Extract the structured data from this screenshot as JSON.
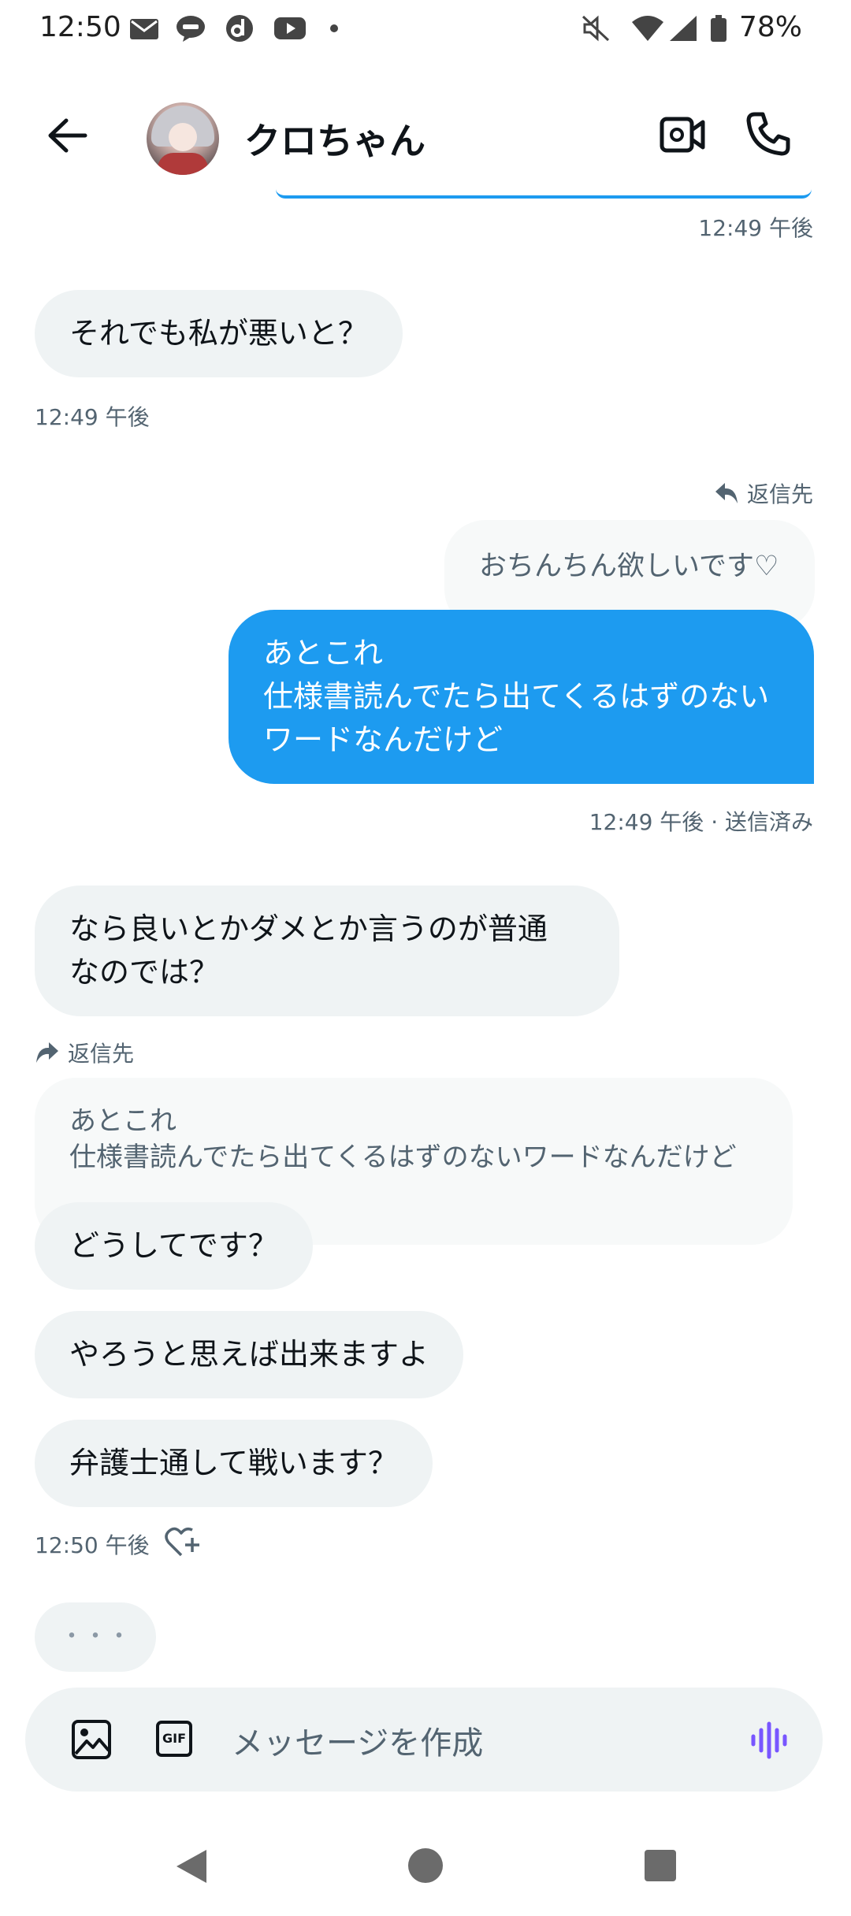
{
  "status_bar": {
    "time": "12:50",
    "battery": "78%",
    "icons": [
      "mail-icon",
      "line-icon",
      "d-app-icon",
      "youtube-icon",
      "dot-icon",
      "mute-icon",
      "wifi-icon",
      "signal-icon",
      "battery-icon"
    ]
  },
  "header": {
    "contact_name": "クロちゃん",
    "icons": [
      "back-arrow-icon",
      "video-call-icon",
      "phone-icon"
    ]
  },
  "messages": {
    "top_time": "12:49 午後",
    "m1": {
      "text": "それでも私が悪いと？",
      "time": "12:49 午後"
    },
    "reply1": {
      "label": "返信先",
      "quoted": "おちんちん欲しいです♡",
      "text": "あとこれ\n仕様書読んでたら出てくるはずのないワードなんだけど",
      "time": "12:49 午後 · 送信済み"
    },
    "m2": {
      "text": "なら良いとかダメとか言うのが普通\nなのでは？"
    },
    "reply2": {
      "label": "返信先",
      "quoted": "あとこれ\n仕様書読んでたら出てくるはずのないワードなんだけど",
      "text": "どうしてです？"
    },
    "m3": {
      "text": "やろうと思えば出来ますよ"
    },
    "m4": {
      "text": "弁護士通して戦います？",
      "time": "12:50 午後"
    },
    "typing": "・・・"
  },
  "composer": {
    "placeholder": "メッセージを作成",
    "icons": [
      "image-icon",
      "gif-icon",
      "voice-icon"
    ],
    "gif_label": "GIF"
  },
  "nav": {
    "icons": [
      "back-nav-icon",
      "home-nav-icon",
      "recents-nav-icon"
    ]
  },
  "colors": {
    "accent": "#1d9bf0",
    "bubble_in": "#eff3f4",
    "meta_text": "#536471",
    "voice": "#7856ff"
  }
}
